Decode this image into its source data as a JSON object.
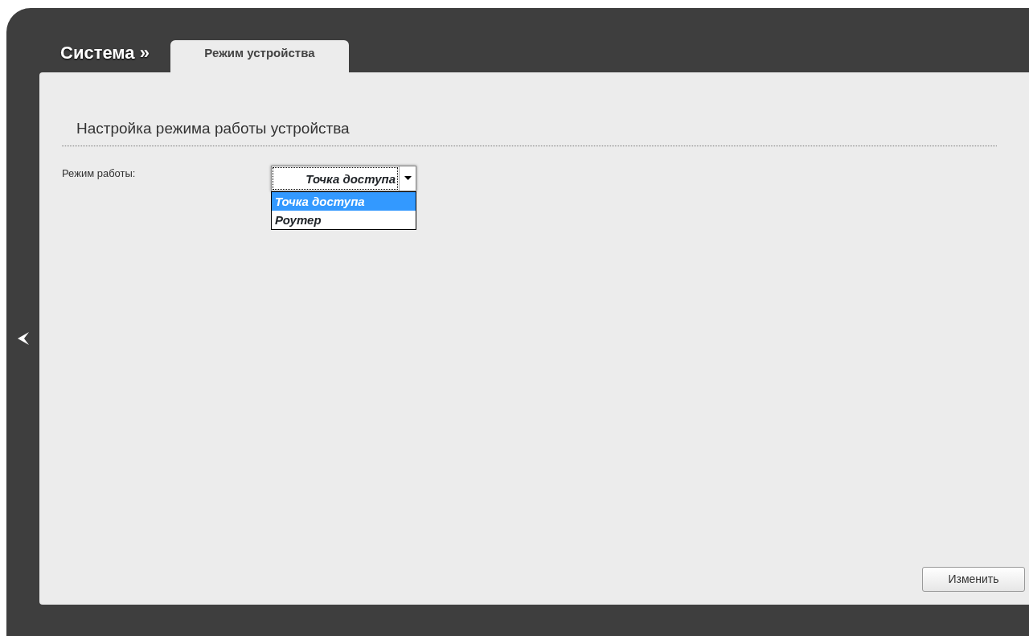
{
  "breadcrumb": "Система »",
  "tabs": [
    {
      "label": "Режим устройства",
      "selected": true
    }
  ],
  "section_title": "Настройка режима работы устройства",
  "fields": [
    {
      "label": "Режим работы:",
      "value": "Точка доступа",
      "expanded": true,
      "options": [
        {
          "label": "Точка доступа",
          "selected": true
        },
        {
          "label": "Роутер",
          "selected": false
        }
      ]
    }
  ],
  "buttons": [
    "Изменить"
  ]
}
